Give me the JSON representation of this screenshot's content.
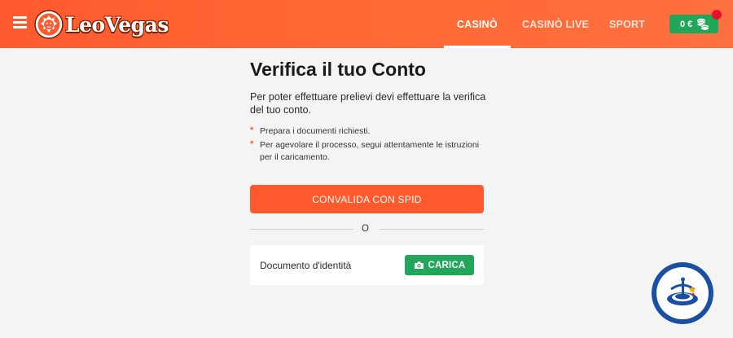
{
  "header": {
    "brand": "LeoVegas",
    "nav": [
      {
        "label": "CASINÒ",
        "active": true
      },
      {
        "label": "CASINÒ LIVE",
        "active": false
      },
      {
        "label": "SPORT",
        "active": false
      }
    ],
    "balance": "0 €",
    "accent_color": "#ff5a2e",
    "success_color": "#22a65a",
    "notification_color": "#e8112d"
  },
  "main": {
    "title": "Verifica il tuo Conto",
    "description": "Per poter effettuare prelievi devi effettuare la verifica del tuo conto.",
    "bullets": [
      "Prepara i documenti richiesti.",
      "Per agevolare il processo, segui attentamente le istruzioni per il caricamento."
    ],
    "spid_button": "CONVALIDA CON SPID",
    "divider_text": "O",
    "document": {
      "label": "Documento d'identità",
      "upload_button": "CARICA",
      "upload_icon": "camera-icon"
    }
  },
  "icons": {
    "menu": "hamburger-menu-icon",
    "logo": "lion-head-logo-icon",
    "balance": "coins-icon",
    "help_badge": "spinning-top-badge-icon"
  }
}
